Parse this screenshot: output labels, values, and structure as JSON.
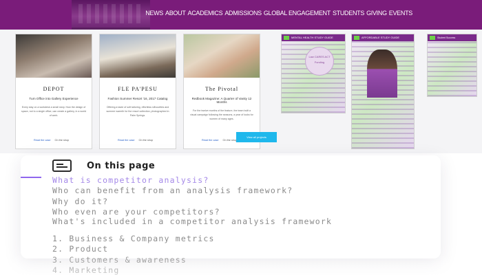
{
  "nav": {
    "items": [
      "NEWS",
      "ABOUT",
      "ACADEMICS",
      "ADMISSIONS",
      "GLOBAL ENGAGEMENT",
      "STUDENTS",
      "GIVING",
      "EVENTS"
    ]
  },
  "cards": [
    {
      "title": "DEPOT",
      "subtitle": "Turn Office into Gallery Experience",
      "body": "Every stay on a workdesk a small story. How the design of space, not to a single office, can create a gallery, in a world of work.",
      "link_read": "Read the case",
      "link_follow": "On the shop"
    },
    {
      "title": "FLE PA'PESU",
      "subtitle": "Fashion Summer Resort '16, 2017 Catalog",
      "body": "Offering a taste of soft tailoring, effortless silhouettes and summer warmth for the resort collection, photographed in Palm Springs.",
      "link_read": "Read the case",
      "link_follow": "On the shop"
    },
    {
      "title": "The Pivotal",
      "subtitle": "Redbook Magazine: A Quarter of Vanity 12 Months",
      "body": "For the twelve months of the feature, the team built a visual campaign following the seasons, a year of looks for women of many ages.",
      "link_read": "Read the case",
      "link_follow": "On the shop"
    }
  ],
  "cta": {
    "label": "View all projects"
  },
  "guides": [
    {
      "header": "MENTAL HEALTH STUDY GUIDE",
      "badge": "Law CARES ACT Funding"
    },
    {
      "header": "AFFORDABLE STUDY GUIDE",
      "badge": ""
    },
    {
      "header": "Student Success",
      "badge": ""
    }
  ],
  "on_this_page": {
    "heading": "On this page",
    "items": [
      "What is competitor analysis?",
      "Who can benefit from an analysis framework?",
      "Why do it?",
      "Who even are your competitors?",
      "What's included in a competitor analysis framework",
      "1. Business & Company metrics",
      "2. Product",
      "3. Customers & awareness",
      "4. Marketing"
    ],
    "active_index": 0
  },
  "colors": {
    "nav_bg": "#7a1c7a",
    "accent": "#a488e8",
    "cta": "#1fb8ec"
  }
}
